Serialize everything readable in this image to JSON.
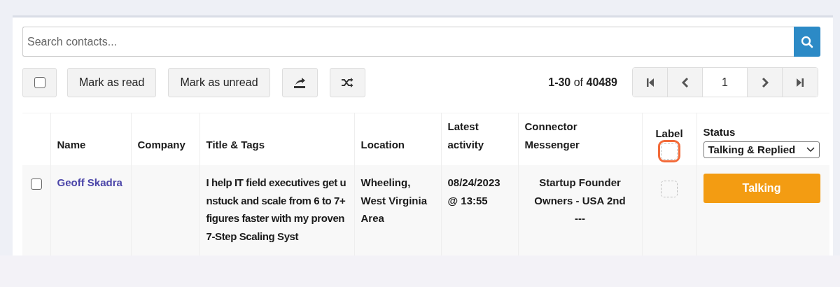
{
  "search": {
    "placeholder": "Search contacts..."
  },
  "toolbar": {
    "select_all": {
      "checked": false
    },
    "buttons": [
      {
        "kind": "text",
        "label": "Mark as read"
      },
      {
        "kind": "text",
        "label": "Mark as unread"
      },
      {
        "kind": "export"
      },
      {
        "kind": "shuffle"
      }
    ]
  },
  "pagination": {
    "range": "1-30",
    "of": "of",
    "total": "40489",
    "page": "1"
  },
  "table": {
    "columns": [
      {
        "kind": "check"
      },
      {
        "kind": "text",
        "label": "Name"
      },
      {
        "kind": "text",
        "label": "Company"
      },
      {
        "kind": "text",
        "label": "Title & Tags"
      },
      {
        "kind": "text",
        "label": "Location"
      },
      {
        "kind": "text",
        "label": "Latest activity"
      },
      {
        "kind": "text",
        "label": "Connector Messenger"
      },
      {
        "kind": "label",
        "label": "Label",
        "highlighted": true
      },
      {
        "kind": "status",
        "label": "Status",
        "filter": "Talking & Replied"
      }
    ],
    "rows": [
      {
        "checked": false,
        "name": "Geoff Skadra",
        "title": "I help IT field executives get unstuck and scale from 6 to 7+ figures faster with my proven 7-Step Scaling Syst",
        "location": "Wheeling, West Virginia Area",
        "latest_activity": "08/24/2023 @ 13:55",
        "connector": [
          "Startup Founder Owners - USA 2nd",
          "---"
        ],
        "status": "Talking"
      }
    ]
  }
}
